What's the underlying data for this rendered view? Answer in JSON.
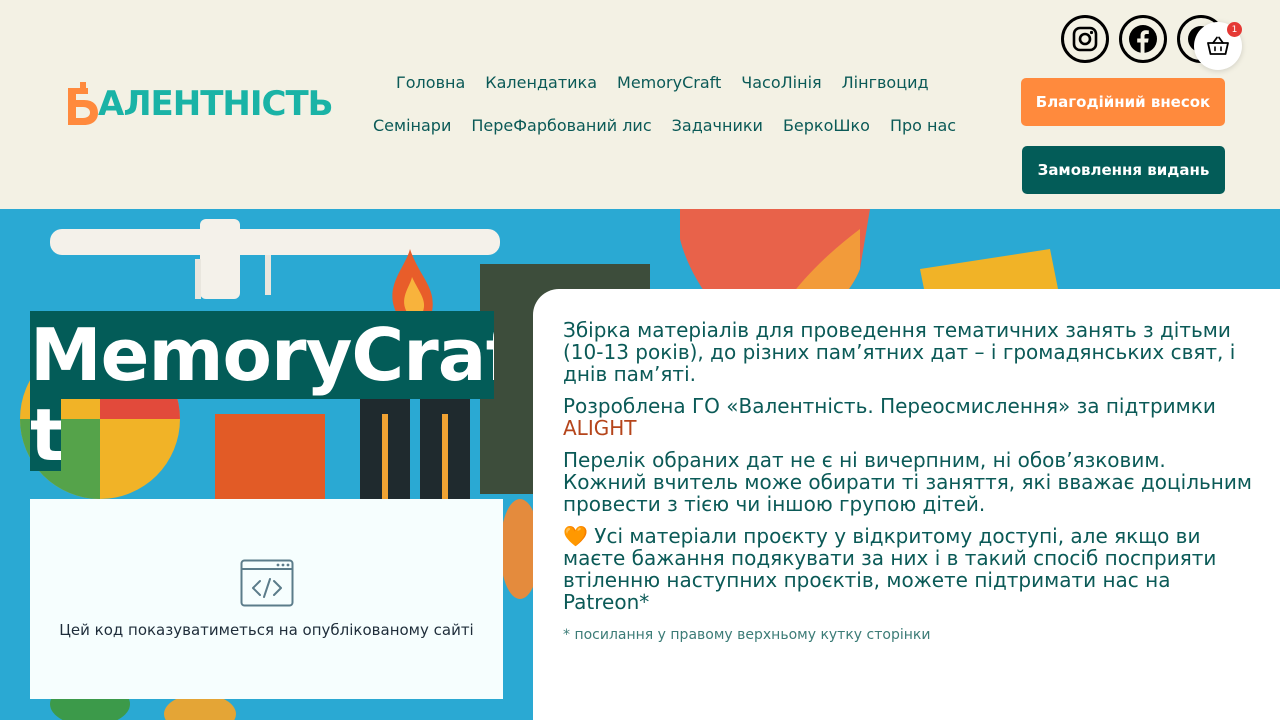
{
  "logo": {
    "text": "АЛЕНТНІСТЬ",
    "letter": "В"
  },
  "nav": {
    "row1": [
      "Головна",
      "Календатика",
      "MemoryCraft",
      "ЧасоЛінія",
      "Лінгвоцид"
    ],
    "row2": [
      "Семінари",
      "ПереФарбований лис",
      "Задачники",
      "БеркоШко",
      "Про нас"
    ]
  },
  "social": [
    "instagram-icon",
    "facebook-icon",
    "patreon-icon"
  ],
  "cart": {
    "count": "1"
  },
  "buttons": {
    "donate": "Благодійний внесок",
    "order": "Замовлення видань"
  },
  "hero": {
    "title_line1": "MemoryCraf",
    "title_line2": "t",
    "code_placeholder": "Цей код показуватиметься на опублікованому сайті"
  },
  "card": {
    "p1": "Збірка матеріалів для проведення тематичних занять з дітьми (10-13 років), до різних пам’ятних дат – і громадянських свят, і днів пам’яті.",
    "p2": "Розроблена ГО «Валентність. Переосмислення» за підтримки",
    "p2_link": "ALIGHT",
    "p3": "Перелік обраних дат не є ні вичерпним, ні обов’язковим. Кожний вчитель може обирати ті заняття, які вважає доцільним провести з тією чи іншою групою дітей.",
    "p4_heart": "🧡",
    "p4": "Усі матеріали проєкту у відкритому доступі, але якщо ви маєте бажання подякувати за них і в такий спосіб посприяти втіленню наступних проєктів, можете підтримати нас на Patreon*",
    "note": "* посилання у правому верхньому кутку сторінки"
  },
  "colors": {
    "accent_orange": "#ff8a3d",
    "brand_teal": "#035c58",
    "logo_teal": "#1ab3a6",
    "hero_blue": "#2aa9d3"
  }
}
